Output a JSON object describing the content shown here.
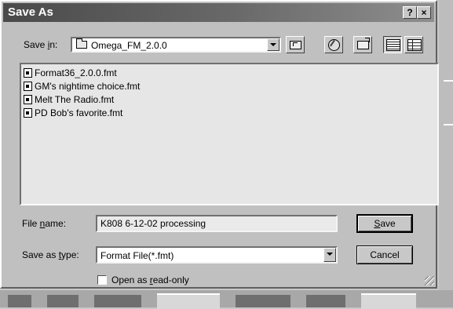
{
  "dialog": {
    "title": "Save As",
    "help_button": "?",
    "close_button": "×"
  },
  "save_in": {
    "label_pre": "Save ",
    "label_key": "i",
    "label_post": "n:",
    "value": "Omega_FM_2.0.0"
  },
  "toolbar": {
    "icons": [
      "up-one-level-icon",
      "internet-globe-icon",
      "create-new-folder-icon",
      "list-view-icon",
      "details-view-icon"
    ]
  },
  "files": [
    "Format36_2.0.0.fmt",
    "GM's nightime choice.fmt",
    "Melt The Radio.fmt",
    "PD Bob's favorite.fmt"
  ],
  "file_name": {
    "label_pre": "File ",
    "label_key": "n",
    "label_post": "ame:",
    "value": "K808 6-12-02 processing"
  },
  "save_as_type": {
    "label_pre": "Save as ",
    "label_key": "t",
    "label_post": "ype:",
    "value": "Format File(*.fmt)"
  },
  "buttons": {
    "save_key": "S",
    "save_rest": "ave",
    "cancel": "Cancel"
  },
  "read_only": {
    "pre": "Open as ",
    "key": "r",
    "post": "ead-only",
    "checked": false
  },
  "colors": {
    "titlebar_start": "#4a4a4a",
    "titlebar_end": "#8e8e8e",
    "face": "#c0c0c0"
  }
}
